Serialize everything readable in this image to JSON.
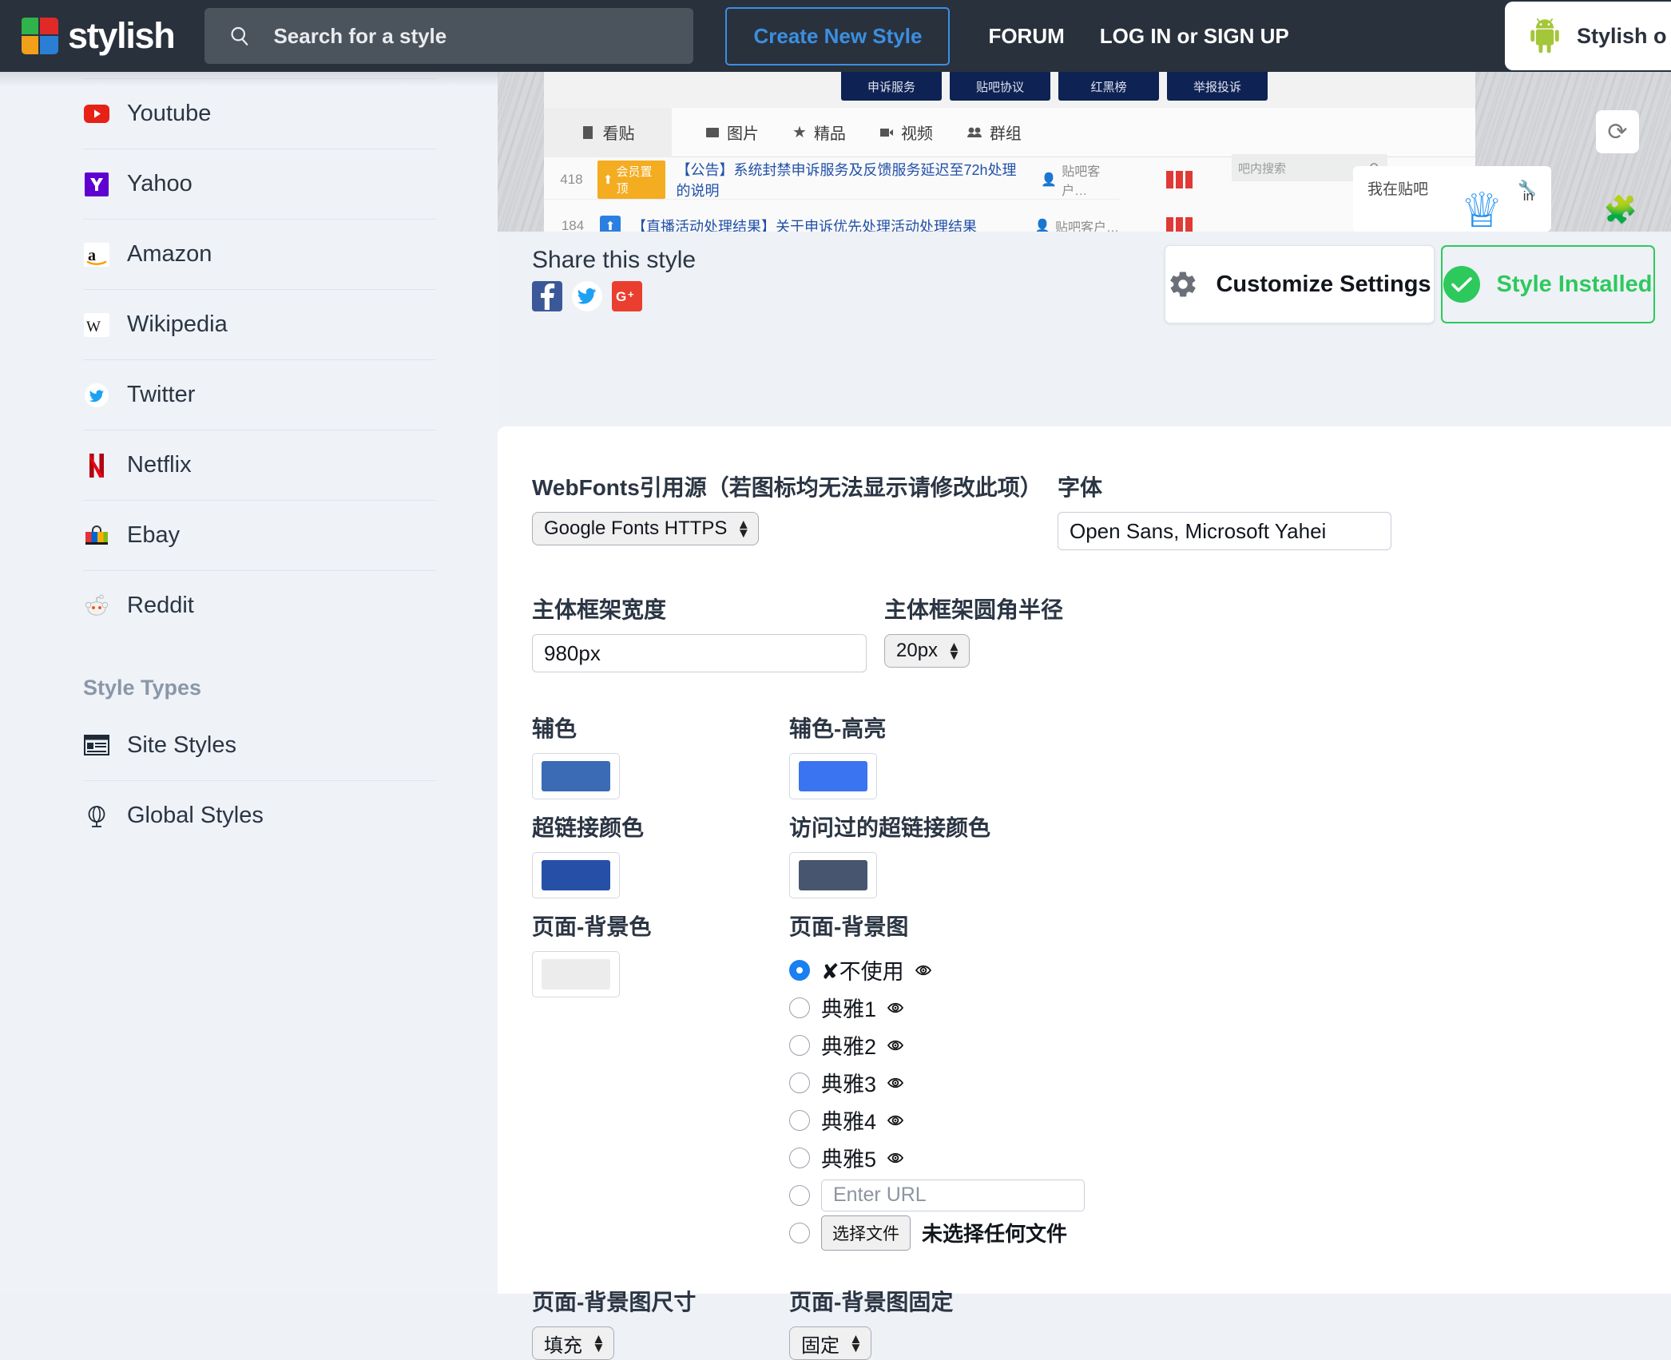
{
  "header": {
    "brand_name": "stylish",
    "brand_logo_icon": "stylish-logo",
    "search": {
      "placeholder": "Search for a style",
      "icon": "search-icon"
    },
    "create_new_style": "Create New Style",
    "forum": "FORUM",
    "log_in_or_sign_up": "LOG IN or SIGN UP",
    "extension": {
      "icon": "android-icon",
      "label": "Stylish o"
    }
  },
  "sidebar": {
    "sites": [
      {
        "label": "Youtube",
        "icon": "youtube-icon"
      },
      {
        "label": "Yahoo",
        "icon": "yahoo-icon"
      },
      {
        "label": "Amazon",
        "icon": "amazon-icon"
      },
      {
        "label": "Wikipedia",
        "icon": "wikipedia-icon"
      },
      {
        "label": "Twitter",
        "icon": "twitter-icon"
      },
      {
        "label": "Netflix",
        "icon": "netflix-icon"
      },
      {
        "label": "Ebay",
        "icon": "ebay-icon"
      },
      {
        "label": "Reddit",
        "icon": "reddit-icon"
      }
    ],
    "style_types_title": "Style Types",
    "style_types": [
      {
        "label": "Site Styles",
        "icon": "site-styles-icon"
      },
      {
        "label": "Global Styles",
        "icon": "global-styles-icon"
      }
    ]
  },
  "preview": {
    "dark_tabs": [
      "申诉服务",
      "贴吧协议",
      "红黑榜",
      "举报投诉"
    ],
    "nav_items": [
      "看贴",
      "图片",
      "精品",
      "视频",
      "群组"
    ],
    "search_placeholder": "吧内搜索",
    "threads": [
      {
        "count": "418",
        "badge": "会员置顶",
        "title": "【公告】系统封禁申诉服务及反馈服务延迟至72h处理的说明",
        "author": "贴吧客户…"
      },
      {
        "count": "184",
        "badge": "",
        "title": "【直播活动处理结果】关于申诉优先处理活动处理结果",
        "author": "贴吧客户…"
      }
    ],
    "right_panel_label": "我在贴吧",
    "in_label": "in"
  },
  "share": {
    "title": "Share this style",
    "buttons": [
      {
        "name": "facebook",
        "glyph": "f"
      },
      {
        "name": "twitter",
        "glyph": "t"
      },
      {
        "name": "googleplus",
        "glyph": "G+"
      }
    ]
  },
  "actions": {
    "customize_settings": "Customize Settings",
    "customize_icon": "gear-icon",
    "style_installed": "Style Installed",
    "installed_icon": "check-icon"
  },
  "settings": {
    "webfonts_label": "WebFonts引用源（若图标均无法显示请修改此项）",
    "webfonts_value": "Google Fonts HTTPS",
    "font_label": "字体",
    "font_value": "Open Sans, Microsoft Yahei",
    "frame_width_label": "主体框架宽度",
    "frame_width_value": "980px",
    "frame_radius_label": "主体框架圆角半径",
    "frame_radius_value": "20px",
    "accent_label": "辅色",
    "accent_color": "#3b6bb5",
    "accent_highlight_label": "辅色-高亮",
    "accent_highlight_color": "#3b74f0",
    "link_color_label": "超链接颜色",
    "link_color": "#2650a8",
    "visited_link_label": "访问过的超链接颜色",
    "visited_link_color": "#47566e",
    "page_bg_color_label": "页面-背景色",
    "page_bg_color": "#ececec",
    "page_bg_image_label": "页面-背景图",
    "bg_options": [
      {
        "label": "✘不使用",
        "selected": true,
        "preview_icon": "eye-icon"
      },
      {
        "label": "典雅1",
        "selected": false,
        "preview_icon": "eye-icon"
      },
      {
        "label": "典雅2",
        "selected": false,
        "preview_icon": "eye-icon"
      },
      {
        "label": "典雅3",
        "selected": false,
        "preview_icon": "eye-icon"
      },
      {
        "label": "典雅4",
        "selected": false,
        "preview_icon": "eye-icon"
      },
      {
        "label": "典雅5",
        "selected": false,
        "preview_icon": "eye-icon"
      }
    ],
    "url_placeholder": "Enter URL",
    "file_button": "选择文件",
    "file_status": "未选择任何文件",
    "bg_size_label": "页面-背景图尺寸",
    "bg_size_value": "填充",
    "bg_fixed_label": "页面-背景图固定",
    "bg_fixed_value": "固定"
  }
}
